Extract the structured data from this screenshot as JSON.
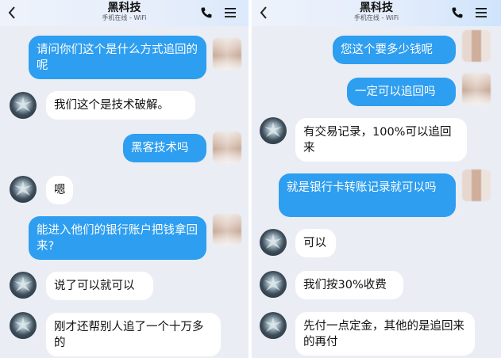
{
  "chat": {
    "title": "黑科技",
    "subtitle": "手机在线 - WiFi",
    "left": {
      "messages": [
        {
          "side": "out",
          "text": "请问你们这个是什么方式追回的呢"
        },
        {
          "side": "in",
          "text": "我们这个是技术破解。"
        },
        {
          "side": "out",
          "text": "黑客技术吗"
        },
        {
          "side": "in",
          "text": "嗯"
        },
        {
          "side": "out",
          "text": "能进入他们的银行账户把钱拿回来?"
        },
        {
          "side": "in",
          "text": "说了可以就可以"
        },
        {
          "side": "in",
          "text": "刚才还帮别人追了一个十万多的"
        }
      ]
    },
    "right": {
      "messages": [
        {
          "side": "out",
          "text": "您这个要多少钱呢"
        },
        {
          "side": "out",
          "text": "一定可以追回吗"
        },
        {
          "side": "in",
          "text": "有交易记录，100%可以追回来"
        },
        {
          "side": "out",
          "text": "就是银行卡转账记录就可以吗"
        },
        {
          "side": "in",
          "text": "可以"
        },
        {
          "side": "in",
          "text": "我们按30%收费"
        },
        {
          "side": "in",
          "text": "先付一点定金，其他的是追回来的再付"
        }
      ]
    }
  },
  "colors": {
    "outgoing_bubble": "#2e9ef0",
    "incoming_bubble": "#ffffff",
    "background": "#eaedf4"
  },
  "icons": {
    "back": "chevron-left-icon",
    "call": "phone-icon",
    "menu": "menu-icon"
  }
}
